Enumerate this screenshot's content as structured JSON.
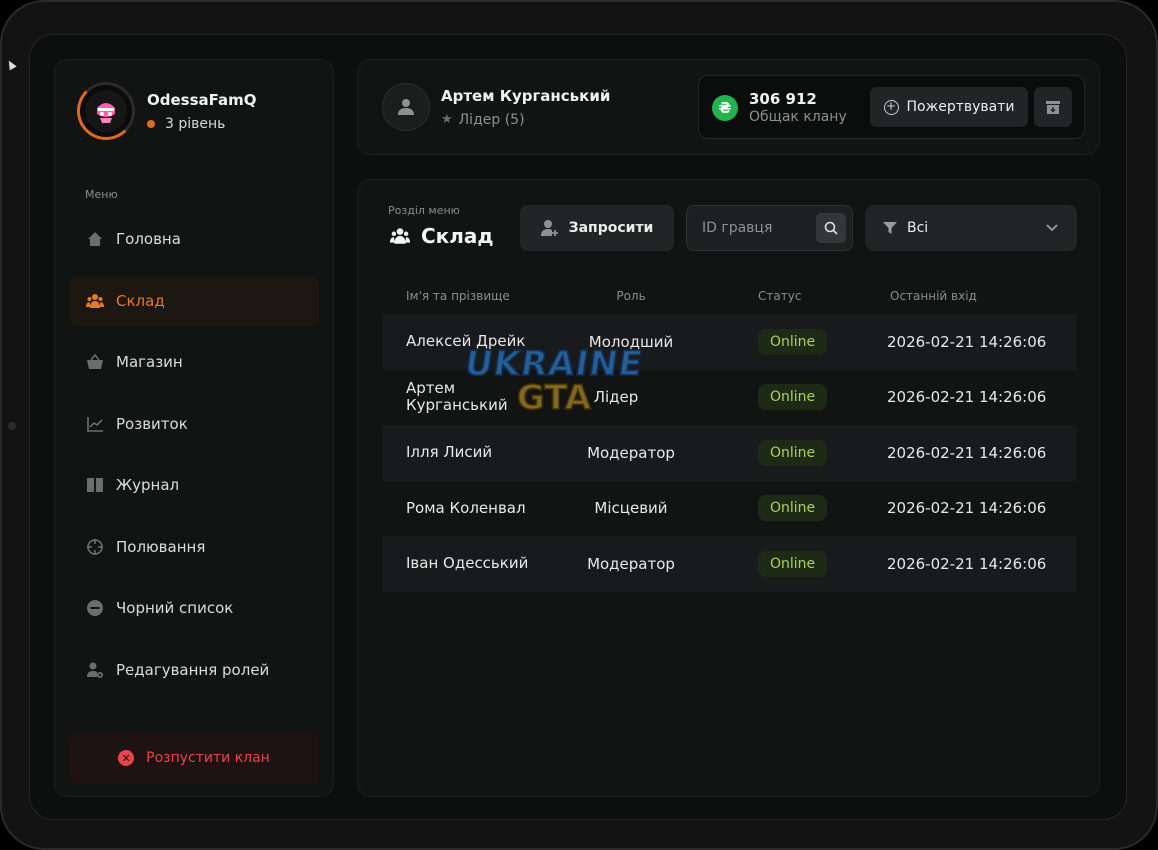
{
  "sidebar": {
    "clan_name": "OdessaFamQ",
    "clan_level": "3 рівень",
    "menu_label": "Меню",
    "items": [
      {
        "label": "Головна",
        "icon": "home-icon",
        "active": false
      },
      {
        "label": "Склад",
        "icon": "users-icon",
        "active": true
      },
      {
        "label": "Магазин",
        "icon": "basket-icon",
        "active": false
      },
      {
        "label": "Розвиток",
        "icon": "chart-icon",
        "active": false
      },
      {
        "label": "Журнал",
        "icon": "book-icon",
        "active": false
      },
      {
        "label": "Полювання",
        "icon": "crosshair-icon",
        "active": false
      },
      {
        "label": "Чорний список",
        "icon": "minus-circle-icon",
        "active": false
      },
      {
        "label": "Редагування ролей",
        "icon": "user-gear-icon",
        "active": false
      }
    ],
    "disband_label": "Розпустити клан"
  },
  "header": {
    "leader_name": "Артем Курганський",
    "leader_role": "Лідер (5)",
    "bank_amount": "306 912",
    "bank_label": "Общак клану",
    "bank_currency_symbol": "₴",
    "donate_label": "Пожертвувати"
  },
  "main": {
    "section_label": "Розділ меню",
    "section_title": "Склад",
    "invite_label": "Запросити",
    "search_placeholder": "ID гравця",
    "filter_value": "Всі",
    "columns": {
      "name": "Ім'я та прізвище",
      "role": "Роль",
      "status": "Статус",
      "last": "Останній вхід"
    },
    "rows": [
      {
        "name": "Алексей Дрейк",
        "role": "Молодший",
        "status": "Online",
        "last": "2026-02-21 14:26:06"
      },
      {
        "name": "Артем Курганський",
        "role": "Лідер",
        "status": "Online",
        "last": "2026-02-21 14:26:06"
      },
      {
        "name": "Ілля Лисий",
        "role": "Модератор",
        "status": "Online",
        "last": "2026-02-21 14:26:06"
      },
      {
        "name": "Рома Коленвал",
        "role": "Місцевий",
        "status": "Online",
        "last": "2026-02-21 14:26:06"
      },
      {
        "name": "Іван Одесський",
        "role": "Модератор",
        "status": "Online",
        "last": "2026-02-21 14:26:06"
      }
    ]
  },
  "watermark": {
    "line1": "UKRAINE",
    "line2": "GTA"
  },
  "colors": {
    "accent": "#e06a1c",
    "online": "#a7d35a",
    "danger": "#e8454a",
    "money": "#22b34f"
  }
}
